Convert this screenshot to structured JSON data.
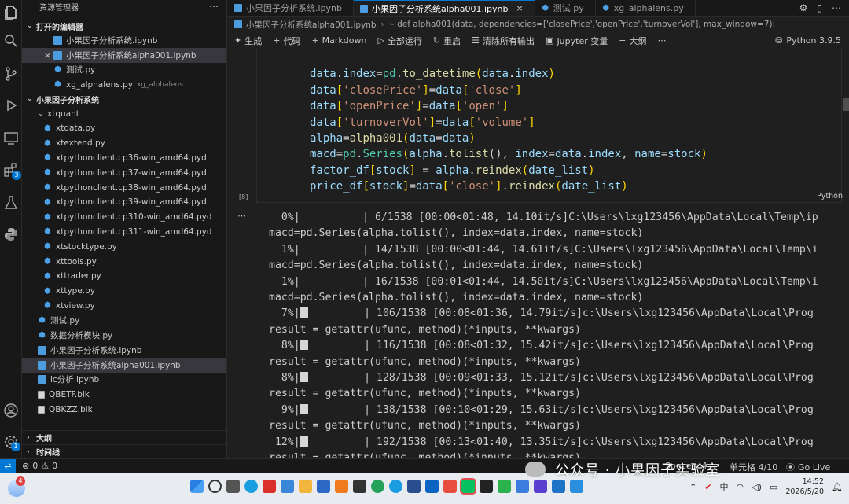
{
  "sidebar": {
    "title": "资源管理器",
    "open_editors_title": "打开的编辑器",
    "open_editors": [
      {
        "name": "小果因子分析系统.ipynb",
        "hint": "",
        "kind": "nb",
        "selected": false,
        "closable": false
      },
      {
        "name": "小果因子分析系统alpha001.ipynb",
        "hint": "",
        "kind": "nb",
        "selected": true,
        "closable": true
      },
      {
        "name": "测试.py",
        "hint": "",
        "kind": "py",
        "selected": false,
        "closable": false
      },
      {
        "name": "xg_alphalens.py",
        "hint": "xg_alphalens",
        "kind": "py",
        "selected": false,
        "closable": false
      }
    ],
    "workspace_title": "小果因子分析系统",
    "folder_name": "xtquant",
    "folder_files": [
      "xtdata.py",
      "xtextend.py",
      "xtpythonclient.cp36-win_amd64.pyd",
      "xtpythonclient.cp37-win_amd64.pyd",
      "xtpythonclient.cp38-win_amd64.pyd",
      "xtpythonclient.cp39-win_amd64.pyd",
      "xtpythonclient.cp310-win_amd64.pyd",
      "xtpythonclient.cp311-win_amd64.pyd",
      "xtstocktype.py",
      "xttools.py",
      "xttrader.py",
      "xttype.py",
      "xtview.py"
    ],
    "root_files": [
      {
        "name": "测试.py",
        "kind": "py",
        "selected": false
      },
      {
        "name": "数据分析模块.py",
        "kind": "py",
        "selected": false
      },
      {
        "name": "小果因子分析系统.ipynb",
        "kind": "nb",
        "selected": false
      },
      {
        "name": "小果因子分析系统alpha001.ipynb",
        "kind": "nb",
        "selected": true
      },
      {
        "name": "ic分析.ipynb",
        "kind": "nb",
        "selected": false
      },
      {
        "name": "QBETF.blk",
        "kind": "blk",
        "selected": false
      },
      {
        "name": "QBKZZ.blk",
        "kind": "blk",
        "selected": false
      }
    ],
    "outline_title": "大纲",
    "timeline_title": "时间线"
  },
  "activity": {
    "extensions_badge": "3",
    "settings_badge": "1"
  },
  "tabs": [
    {
      "label": "小果因子分析系统.ipynb",
      "kind": "nb",
      "active": false
    },
    {
      "label": "小果因子分析系统alpha001.ipynb",
      "kind": "nb",
      "active": true
    },
    {
      "label": "测试.py",
      "kind": "py",
      "active": false
    },
    {
      "label": "xg_alphalens.py",
      "kind": "py",
      "active": false
    }
  ],
  "breadcrumb": {
    "file": "小果因子分析系统alpha001.ipynb",
    "symbol": "def alpha001(data, dependencies=['closePrice','openPrice','turnoverVol'], max_window=7):"
  },
  "toolbar": {
    "generate": "生成",
    "code": "代码",
    "markdown": "Markdown",
    "run_all": "全部运行",
    "restart": "重启",
    "clear_outputs": "清除所有输出",
    "variables": "Jupyter 变量",
    "outline": "大纲",
    "kernel": "Python 3.9.5"
  },
  "cell": {
    "exec_count": "[8]",
    "language": "Python",
    "lines": [
      "data.index=pd.to_datetime(data.index)",
      "data['closePrice']=data['close']",
      "data['openPrice']=data['open']",
      "data['turnoverVol']=data['volume']",
      "alpha=alpha001(data=data)",
      "macd=pd.Series(alpha.tolist(), index=data.index, name=stock)",
      "factor_df[stock] = alpha.reindex(date_list)",
      "price_df[stock]=data['close'].reindex(date_list)"
    ]
  },
  "output": {
    "lines": [
      {
        "pct": "  0%|",
        "bar": false,
        "rest": "          | 6/1538 [00:00<01:48, 14.10it/s]C:\\Users\\lxg123456\\AppData\\Local\\Temp\\ip"
      },
      {
        "pct": "",
        "bar": false,
        "rest": "macd=pd.Series(alpha.tolist(), index=data.index, name=stock)"
      },
      {
        "pct": "  1%|",
        "bar": false,
        "rest": "          | 14/1538 [00:00<01:44, 14.61it/s]C:\\Users\\lxg123456\\AppData\\Local\\Temp\\i"
      },
      {
        "pct": "",
        "bar": false,
        "rest": "macd=pd.Series(alpha.tolist(), index=data.index, name=stock)"
      },
      {
        "pct": "  1%|",
        "bar": false,
        "rest": "          | 16/1538 [00:01<01:44, 14.50it/s]C:\\Users\\lxg123456\\AppData\\Local\\Temp\\i"
      },
      {
        "pct": "",
        "bar": false,
        "rest": "macd=pd.Series(alpha.tolist(), index=data.index, name=stock)"
      },
      {
        "pct": "  7%|",
        "bar": true,
        "rest": "         | 106/1538 [00:08<01:36, 14.79it/s]c:\\Users\\lxg123456\\AppData\\Local\\Prog"
      },
      {
        "pct": "",
        "bar": false,
        "rest": "result = getattr(ufunc, method)(*inputs, **kwargs)"
      },
      {
        "pct": "  8%|",
        "bar": true,
        "rest": "         | 116/1538 [00:08<01:32, 15.42it/s]c:\\Users\\lxg123456\\AppData\\Local\\Prog"
      },
      {
        "pct": "",
        "bar": false,
        "rest": "result = getattr(ufunc, method)(*inputs, **kwargs)"
      },
      {
        "pct": "  8%|",
        "bar": true,
        "rest": "         | 128/1538 [00:09<01:33, 15.12it/s]c:\\Users\\lxg123456\\AppData\\Local\\Prog"
      },
      {
        "pct": "",
        "bar": false,
        "rest": "result = getattr(ufunc, method)(*inputs, **kwargs)"
      },
      {
        "pct": "  9%|",
        "bar": true,
        "rest": "         | 138/1538 [00:10<01:29, 15.63it/s]c:\\Users\\lxg123456\\AppData\\Local\\Prog"
      },
      {
        "pct": "",
        "bar": false,
        "rest": "result = getattr(ufunc, method)(*inputs, **kwargs)"
      },
      {
        "pct": " 12%|",
        "bar": true,
        "rest": "         | 192/1538 [00:13<01:40, 13.35it/s]c:\\Users\\lxg123456\\AppData\\Local\\Prog"
      },
      {
        "pct": "",
        "bar": false,
        "rest": "result = getattr(ufunc, method)(*inputs, **kwargs)"
      }
    ]
  },
  "statusbar": {
    "errors": "0",
    "warnings": "0",
    "spaces": "Spaces: 4",
    "cell_pos": "单元格 4/10",
    "golive": "Go Live"
  },
  "taskbar": {
    "notify_badge": "4",
    "time": "14:52",
    "date": "2026/5/20",
    "ime": "中"
  },
  "watermark": "公众号 · 小果因子实验室",
  "colors": {
    "accent": "#0078d4",
    "editor_bg": "#1f1f1f",
    "sidebar_bg": "#181818",
    "selected": "#37373d",
    "string": "#ce9178",
    "func": "#dcdcaa",
    "var": "#9cdcfe"
  }
}
